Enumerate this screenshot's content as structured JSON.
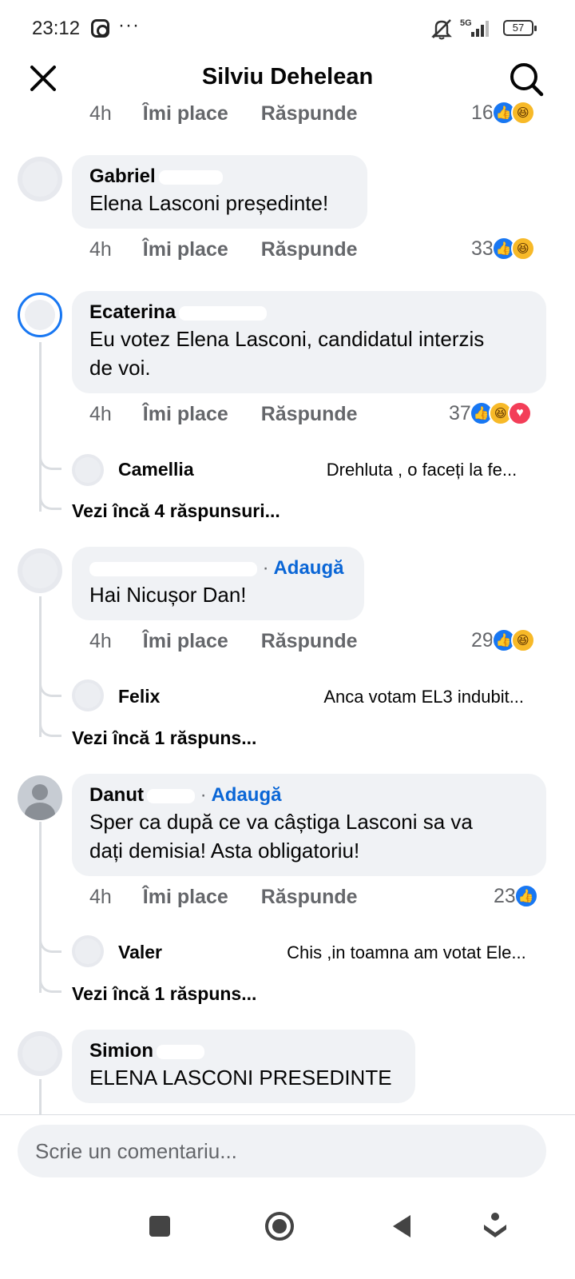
{
  "status_bar": {
    "time": "23:12",
    "dots": "···",
    "network": "5G",
    "battery": "57",
    "icons": [
      "instagram-icon",
      "mute-icon",
      "signal-icon",
      "battery-icon"
    ]
  },
  "header": {
    "title": "Silviu Dehelean",
    "icons": [
      "close-icon",
      "search-icon"
    ]
  },
  "labels": {
    "like": "Îmi place",
    "reply": "Răspunde",
    "add": "Adaugă",
    "dot": "·"
  },
  "comments": [
    {
      "id": "c0",
      "time": "4h",
      "reactions_count": "16",
      "reactions": [
        "like",
        "haha"
      ]
    },
    {
      "id": "c1",
      "author": "Gabriel",
      "text": "Elena Lasconi președinte!",
      "time": "4h",
      "reactions_count": "33",
      "reactions": [
        "like",
        "haha"
      ]
    },
    {
      "id": "c2",
      "author": "Ecaterina",
      "text_line1": "Eu votez Elena Lasconi, candidatul interzis",
      "text_line2": "de voi.",
      "time": "4h",
      "reactions_count": "37",
      "reactions": [
        "like",
        "haha",
        "love"
      ],
      "reply_preview": {
        "author": "Camellia",
        "text": "Drehluta , o faceți la fe..."
      },
      "more_replies": "Vezi încă 4 răspunsuri..."
    },
    {
      "id": "c3",
      "author": "",
      "text": "Hai Nicușor Dan!",
      "time": "4h",
      "reactions_count": "29",
      "reactions": [
        "like",
        "haha"
      ],
      "reply_preview": {
        "author": "Felix",
        "text": "Anca votam EL3 indubit..."
      },
      "more_replies": "Vezi încă 1 răspuns..."
    },
    {
      "id": "c4",
      "author": "Danut",
      "text_line1": "Sper ca după ce va câștiga Lasconi sa va",
      "text_line2": "dați demisia! Asta obligatoriu!",
      "time": "4h",
      "reactions_count": "23",
      "reactions": [
        "like"
      ],
      "reply_preview": {
        "author": "Valer",
        "text": "Chis ,in toamna am votat Ele..."
      },
      "more_replies": "Vezi încă 1 răspuns..."
    },
    {
      "id": "c5",
      "author": "Simion",
      "text": "ELENA LASCONI PRESEDINTE"
    }
  ],
  "composer": {
    "placeholder": "Scrie un comentariu..."
  },
  "colors": {
    "link_blue": "#0a66d6",
    "like_blue": "#1877f2",
    "bubble_gray": "#f0f2f5",
    "meta_gray": "#65676b",
    "love_red": "#f33e58",
    "haha_yellow": "#f7b928"
  },
  "nav_icons": [
    "recents-square-icon",
    "home-circle-icon",
    "back-triangle-icon",
    "assistant-icon"
  ]
}
